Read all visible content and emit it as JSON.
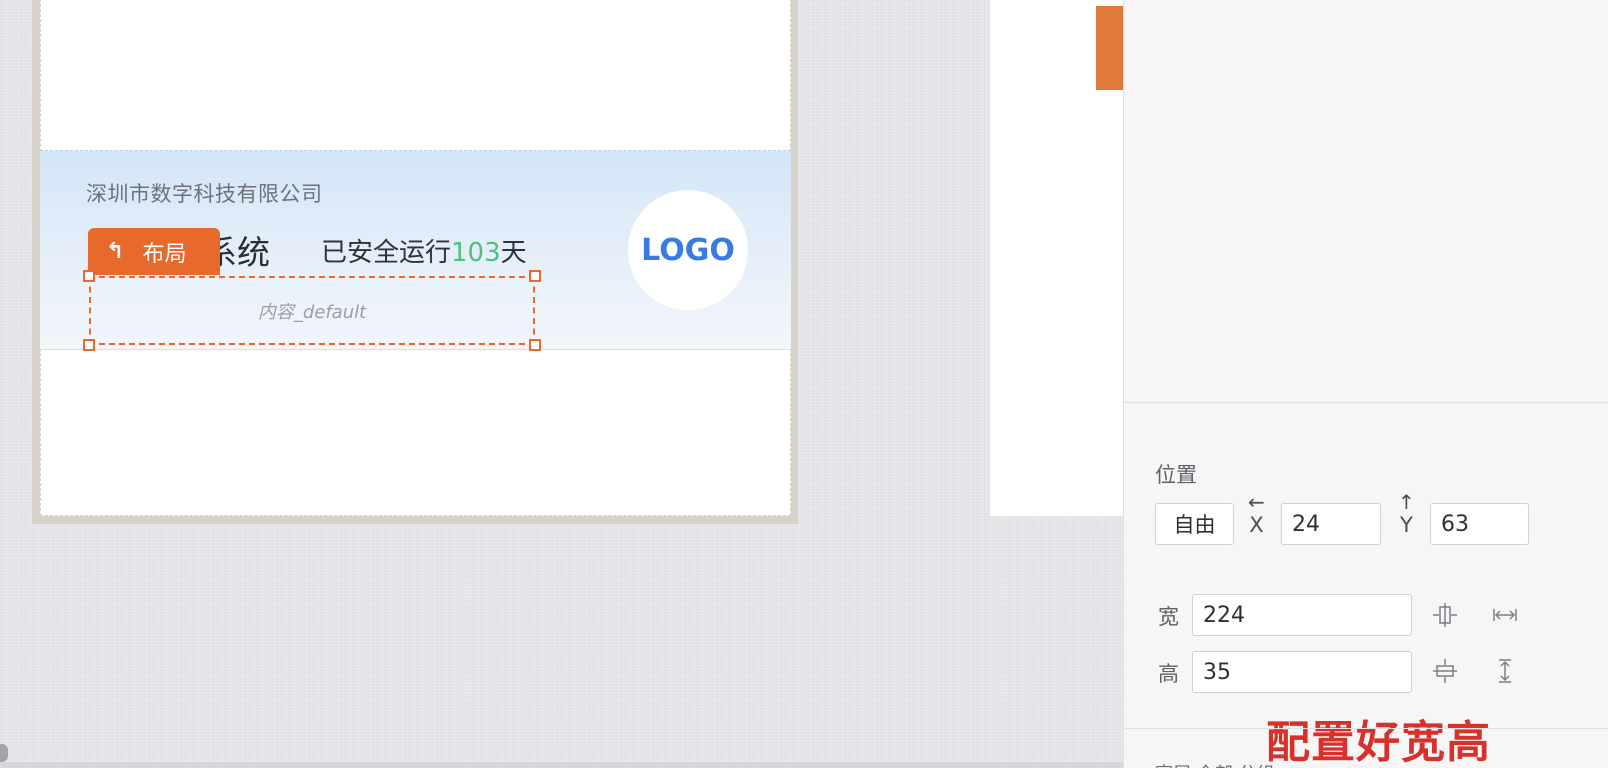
{
  "canvas": {
    "banner": {
      "company_name": "深圳市数字科技有限公司",
      "system_title_visible": "系统",
      "run_prefix": "已安全运行",
      "run_days": "103",
      "run_suffix": "天",
      "logo_text": "LOGO"
    },
    "layout_tag": {
      "icon": "return-up-arrow-icon",
      "label": "布局"
    },
    "selection": {
      "placeholder": "内容_default"
    }
  },
  "properties_panel": {
    "position_section_title": "位置",
    "mode_button": "自由",
    "x_label": "X",
    "x_value": "24",
    "y_label": "Y",
    "y_value": "63",
    "width_label": "宽",
    "width_value": "224",
    "height_label": "高",
    "height_value": "35",
    "truncated_label": "宽屏 全部 分组",
    "icons": [
      "align-center-horizontal-icon",
      "stretch-horizontal-icon",
      "align-center-vertical-icon",
      "stretch-vertical-icon"
    ]
  },
  "annotation": {
    "caption": "配置好宽高"
  },
  "colors": {
    "accent": "#e8692c",
    "run_days": "#4cc27b",
    "logo": "#3a7be3",
    "caption": "#d8312c"
  }
}
